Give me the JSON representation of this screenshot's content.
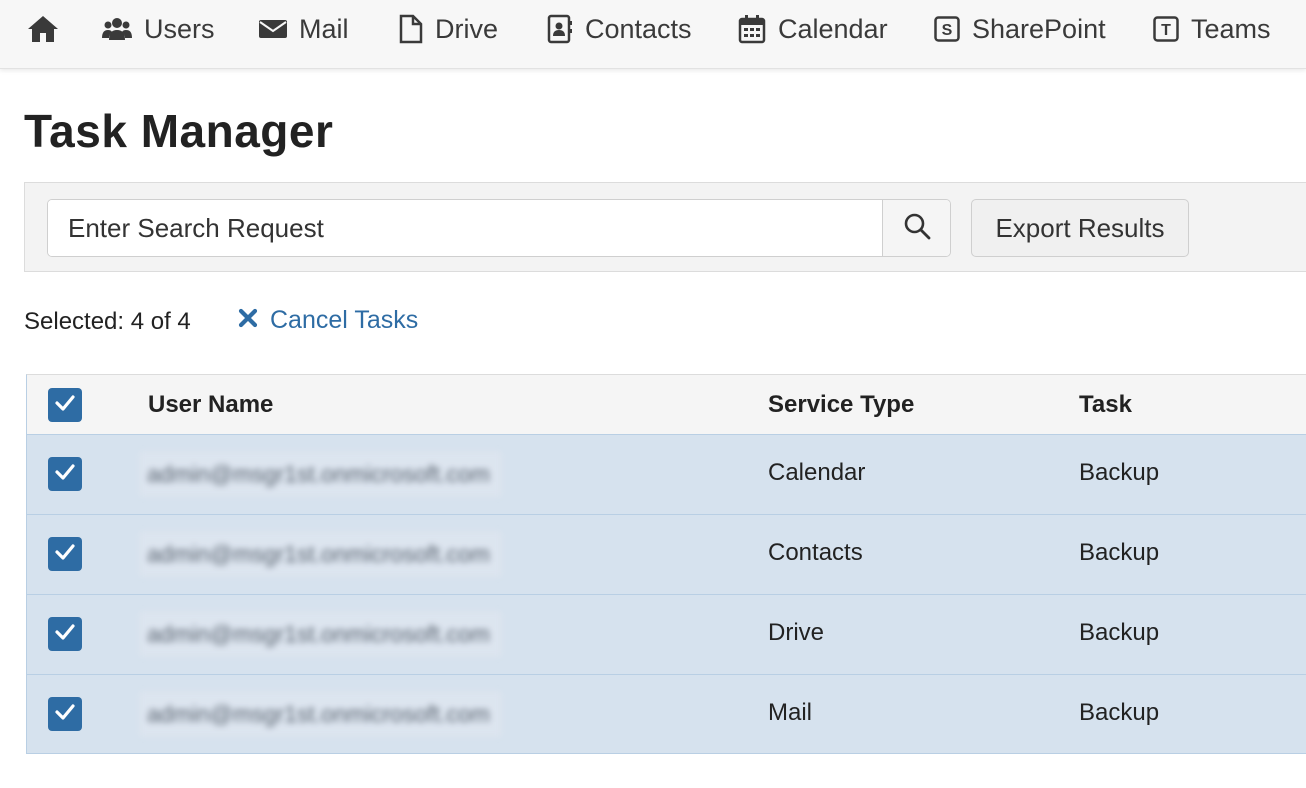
{
  "nav": {
    "home_icon": "home-icon",
    "items": [
      {
        "label": "Users",
        "icon": "users-icon"
      },
      {
        "label": "Mail",
        "icon": "envelope-icon"
      },
      {
        "label": "Drive",
        "icon": "file-icon"
      },
      {
        "label": "Contacts",
        "icon": "address-book-icon"
      },
      {
        "label": "Calendar",
        "icon": "calendar-icon"
      },
      {
        "label": "SharePoint",
        "icon": "sharepoint-icon"
      },
      {
        "label": "Teams",
        "icon": "teams-icon"
      }
    ]
  },
  "page": {
    "title": "Task Manager"
  },
  "search": {
    "placeholder": "Enter Search Request",
    "button_icon": "search-icon",
    "export_label": "Export Results"
  },
  "selection": {
    "text": "Selected: 4 of 4",
    "cancel_label": "Cancel Tasks",
    "cancel_icon": "close-icon"
  },
  "table": {
    "columns": {
      "user_name": "User Name",
      "service_type": "Service Type",
      "task": "Task"
    },
    "rows": [
      {
        "user": "admin@msgr1st.onmicrosoft.com",
        "service": "Calendar",
        "task": "Backup",
        "checked": true
      },
      {
        "user": "admin@msgr1st.onmicrosoft.com",
        "service": "Contacts",
        "task": "Backup",
        "checked": true
      },
      {
        "user": "admin@msgr1st.onmicrosoft.com",
        "service": "Drive",
        "task": "Backup",
        "checked": true
      },
      {
        "user": "admin@msgr1st.onmicrosoft.com",
        "service": "Mail",
        "task": "Backup",
        "checked": true
      }
    ]
  },
  "colors": {
    "accent": "#2e6ca4",
    "selected_row": "#d6e2ee",
    "nav_bg": "#f7f7f7"
  }
}
